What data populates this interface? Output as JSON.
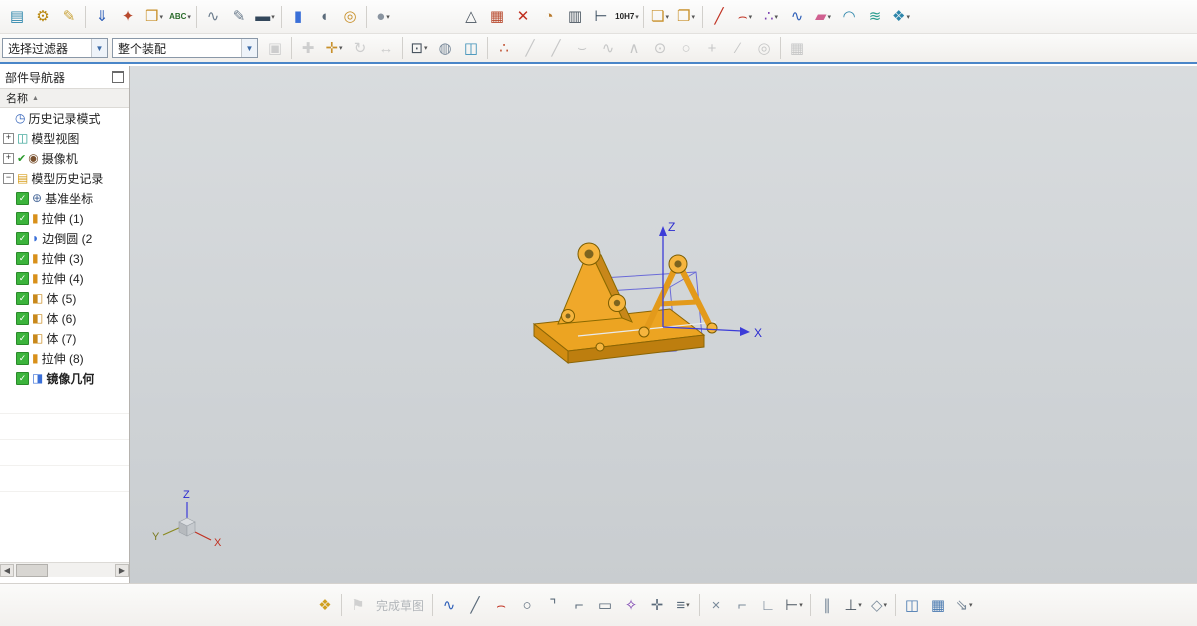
{
  "ribbon": {
    "row1_icons": [
      {
        "n": "layers-icon",
        "g": "▤",
        "c": "#2e86ab"
      },
      {
        "n": "gears-icon",
        "g": "⚙",
        "c": "#b8860b"
      },
      {
        "n": "sketch-doc-icon",
        "g": "✎",
        "c": "#caa43c"
      },
      {
        "sep": true
      },
      {
        "n": "paste-icon",
        "g": "⇓",
        "c": "#2e5fb8"
      },
      {
        "n": "tools-icon",
        "g": "✦",
        "c": "#b84a2e"
      },
      {
        "n": "pmi-box-icon",
        "g": "❒",
        "c": "#c8902a",
        "dd": true
      },
      {
        "n": "text-abc-icon",
        "t": "ABC",
        "c": "#2a6a2a",
        "dd": true
      },
      {
        "sep": true
      },
      {
        "n": "sweep-curve-icon",
        "g": "∿",
        "c": "#6a7b8c"
      },
      {
        "n": "section-pencil-icon",
        "g": "✎",
        "c": "#6a7b8c"
      },
      {
        "n": "ruler-icon",
        "g": "▬",
        "c": "#33475b",
        "dd": true
      },
      {
        "sep": true
      },
      {
        "n": "extrude-icon",
        "g": "▮",
        "c": "#3a6fd8"
      },
      {
        "n": "revolve-icon",
        "g": "◖",
        "c": "#5b6b7b"
      },
      {
        "n": "hole-icon",
        "g": "◎",
        "c": "#c8902a"
      },
      {
        "sep": true
      },
      {
        "n": "sphere-icon",
        "g": "●",
        "c": "#8a94a0",
        "dd": true
      },
      {
        "gap": 62
      },
      {
        "n": "draft-icon",
        "g": "△",
        "c": "#4a5560"
      },
      {
        "n": "table-icon",
        "g": "▦",
        "c": "#b84a2e"
      },
      {
        "n": "edit-feature-icon",
        "g": "✕",
        "c": "#c03020"
      },
      {
        "n": "gauge-icon",
        "g": "◔",
        "c": "#b87a2e"
      },
      {
        "n": "spreadsheet-icon",
        "g": "▥",
        "c": "#4a5560"
      },
      {
        "n": "measure-icon",
        "g": "⊢",
        "c": "#33475b"
      },
      {
        "n": "tolerance-icon",
        "t": "10H7",
        "c": "#222222",
        "dd": true
      },
      {
        "sep": true
      },
      {
        "n": "unite-icon",
        "g": "❏",
        "c": "#c8902a",
        "dd": true
      },
      {
        "n": "pattern-feature-icon",
        "g": "❐",
        "c": "#c8902a",
        "dd": true
      },
      {
        "sep": true
      },
      {
        "n": "line-icon",
        "g": "╱",
        "c": "#c03020"
      },
      {
        "n": "arc-icon",
        "g": "⌢",
        "c": "#c03020",
        "dd": true
      },
      {
        "n": "point-set-icon",
        "g": "∴",
        "c": "#7a3fb0",
        "dd": true
      },
      {
        "n": "spline-icon",
        "g": "∿",
        "c": "#2e5fb8"
      },
      {
        "n": "surface-icon",
        "g": "▰",
        "c": "#d06090",
        "dd": true
      },
      {
        "n": "swept-icon",
        "g": "◠",
        "c": "#2e86ab"
      },
      {
        "n": "through-curves-icon",
        "g": "≋",
        "c": "#2a9d8f"
      },
      {
        "n": "offset-surface-icon",
        "g": "❖",
        "c": "#2e86ab",
        "dd": true
      }
    ],
    "row2": {
      "filter_value": "选择过滤器",
      "scope_value": "整个装配",
      "icons": [
        {
          "n": "snap-toggle-icon",
          "g": "▣",
          "c": "#9aa0a6",
          "dim": true
        },
        {
          "sep": true
        },
        {
          "n": "magnet-plus-icon",
          "g": "✚",
          "c": "#9aa0a6",
          "dim": true
        },
        {
          "n": "point-plus-icon",
          "g": "✛",
          "c": "#c8902a",
          "dd": true
        },
        {
          "n": "rotate-handle-icon",
          "g": "↻",
          "c": "#9aa0a6",
          "dim": true
        },
        {
          "n": "move-handle-icon",
          "g": "↔",
          "c": "#9aa0a6",
          "dim": true
        },
        {
          "sep": true
        },
        {
          "n": "marquee-select-icon",
          "g": "⊡",
          "c": "#4a5560",
          "dd": true
        },
        {
          "n": "shaded-view-icon",
          "g": "◍",
          "c": "#7a8a9a"
        },
        {
          "n": "wireframe-view-icon",
          "g": "◫",
          "c": "#3a8fb7"
        },
        {
          "sep": true
        },
        {
          "n": "snap-pattern-icon",
          "g": "∴",
          "c": "#c05030"
        },
        {
          "n": "snap-endpoint-icon",
          "g": "╱",
          "c": "#8a9096",
          "dim": true
        },
        {
          "n": "snap-midpoint-icon",
          "g": "╱",
          "c": "#8a9096",
          "dim": true
        },
        {
          "n": "snap-tangent-icon",
          "g": "⌣",
          "c": "#8a9096",
          "dim": true
        },
        {
          "n": "snap-spline-icon",
          "g": "∿",
          "c": "#8a9096",
          "dim": true
        },
        {
          "n": "snap-vertex-icon",
          "g": "∧",
          "c": "#8a9096",
          "dim": true
        },
        {
          "n": "snap-center-icon",
          "g": "⊙",
          "c": "#8a9096",
          "dim": true
        },
        {
          "n": "snap-circle-icon",
          "g": "○",
          "c": "#8a9096",
          "dim": true
        },
        {
          "n": "snap-point-icon",
          "g": "+",
          "c": "#8a9096",
          "dim": true
        },
        {
          "n": "snap-line-icon",
          "g": "∕",
          "c": "#8a9096",
          "dim": true
        },
        {
          "n": "snap-quadrant-icon",
          "g": "◎",
          "c": "#8a9096",
          "dim": true
        },
        {
          "sep": true
        },
        {
          "n": "grid-icon",
          "g": "▦",
          "c": "#8a9096",
          "dim": true
        }
      ]
    }
  },
  "navigator": {
    "title": "部件导航器",
    "name_header": "名称",
    "sort_arrow": "▲",
    "top_items": [
      {
        "name": "history-mode",
        "label": "历史记录模式",
        "icon": "clock-icon",
        "glyph": "◷",
        "color": "#2e5fb8",
        "expand": ""
      },
      {
        "name": "model-views",
        "label": "模型视图",
        "icon": "model-views-icon",
        "glyph": "◫",
        "color": "#2a9d8f",
        "expand": "+"
      },
      {
        "name": "cameras",
        "label": "摄像机",
        "icon": "camera-icon",
        "glyph": "◉",
        "color": "#7a5230",
        "expand": "+",
        "check": "✔"
      },
      {
        "name": "model-history",
        "label": "模型历史记录",
        "icon": "folder-icon",
        "glyph": "▤",
        "color": "#d8a020",
        "expand": "−"
      }
    ],
    "features": [
      {
        "name": "datum-csys",
        "label": "基准坐标",
        "icon": "datum-csys-icon",
        "glyph": "⊕",
        "color": "#4a6a9a",
        "checked": "✓"
      },
      {
        "name": "extrude-1",
        "label": "拉伸 (1)",
        "icon": "extrude-icon",
        "glyph": "▮",
        "color": "#d8901a",
        "checked": "✓"
      },
      {
        "name": "edge-blend-2",
        "label": "边倒圆 (2",
        "icon": "edge-blend-icon",
        "glyph": "◗",
        "color": "#3a6fd8",
        "checked": "✓"
      },
      {
        "name": "extrude-3",
        "label": "拉伸 (3)",
        "icon": "extrude-icon",
        "glyph": "▮",
        "color": "#d8901a",
        "checked": "✓"
      },
      {
        "name": "extrude-4",
        "label": "拉伸 (4)",
        "icon": "extrude-icon",
        "glyph": "▮",
        "color": "#d8901a",
        "checked": "✓"
      },
      {
        "name": "body-5",
        "label": "体 (5)",
        "icon": "body-icon",
        "glyph": "◧",
        "color": "#c8881a",
        "checked": "✓"
      },
      {
        "name": "body-6",
        "label": "体 (6)",
        "icon": "body-icon",
        "glyph": "◧",
        "color": "#c8881a",
        "checked": "✓"
      },
      {
        "name": "body-7",
        "label": "体 (7)",
        "icon": "body-icon",
        "glyph": "◧",
        "color": "#c8881a",
        "checked": "✓"
      },
      {
        "name": "extrude-8",
        "label": "拉伸 (8)",
        "icon": "extrude-icon",
        "glyph": "▮",
        "color": "#d8901a",
        "checked": "✓"
      },
      {
        "name": "mirror-geometry",
        "label": "镜像几何",
        "icon": "mirror-geometry-icon",
        "glyph": "◨",
        "color": "#3a6fd8",
        "checked": "✓",
        "bold": true
      }
    ]
  },
  "viewport": {
    "axes": {
      "z": "Z",
      "x": "X"
    },
    "triad": {
      "z": "Z",
      "y": "Y",
      "x": "X"
    },
    "model_color": "#eca422",
    "axis_color": "#3c3cd8"
  },
  "bottom_icons": [
    {
      "n": "sketch-task-icon",
      "g": "❖",
      "c": "#d0a020"
    },
    {
      "sep": true
    },
    {
      "n": "finish-sketch-icon",
      "g": "⚑",
      "c": "#a0a4a8",
      "dim": true
    },
    {
      "n": "finish-sketch-label",
      "lbl": "完成草图"
    },
    {
      "sep": true
    },
    {
      "n": "profile-icon",
      "g": "∿",
      "c": "#2e5fb8"
    },
    {
      "n": "line-icon",
      "g": "╱",
      "c": "#5a6a7a"
    },
    {
      "n": "arc-icon",
      "g": "⌢",
      "c": "#c03020"
    },
    {
      "n": "circle-icon",
      "g": "○",
      "c": "#5a6a7a"
    },
    {
      "n": "corner-arc-icon",
      "g": "⌝",
      "c": "#5a6a7a"
    },
    {
      "n": "chamfer-icon",
      "g": "⌐",
      "c": "#5a6a7a"
    },
    {
      "n": "rectangle-icon",
      "g": "▭",
      "c": "#5a6a7a"
    },
    {
      "n": "studio-spline-icon",
      "g": "✧",
      "c": "#7a3fb0"
    },
    {
      "n": "point-icon",
      "g": "✛",
      "c": "#5a6a7a"
    },
    {
      "n": "offset-curve-icon",
      "g": "≡",
      "c": "#5a6a7a",
      "dd": true
    },
    {
      "sep": true
    },
    {
      "n": "quick-trim-icon",
      "g": "×",
      "c": "#7a8a9a"
    },
    {
      "n": "quick-extend-icon",
      "g": "⌐",
      "c": "#7a8a9a"
    },
    {
      "n": "make-corner-icon",
      "g": "∟",
      "c": "#7a8a9a"
    },
    {
      "n": "dimension-icon",
      "g": "⊢",
      "c": "#4a5560",
      "dd": true
    },
    {
      "sep": true
    },
    {
      "n": "parallel-constraint-icon",
      "g": "∥",
      "c": "#7a8a9a"
    },
    {
      "n": "constraints-icon",
      "g": "⊥",
      "c": "#4a5560",
      "dd": true
    },
    {
      "n": "show-constraints-icon",
      "g": "◇",
      "c": "#7a8a9a",
      "dd": true
    },
    {
      "sep": true
    },
    {
      "n": "mirror-curve-icon",
      "g": "◫",
      "c": "#4a7ab0"
    },
    {
      "n": "pattern-curve-icon",
      "g": "▦",
      "c": "#4a7ab0"
    },
    {
      "n": "project-curve-icon",
      "g": "⇘",
      "c": "#7a8a9a",
      "dd": true
    }
  ]
}
